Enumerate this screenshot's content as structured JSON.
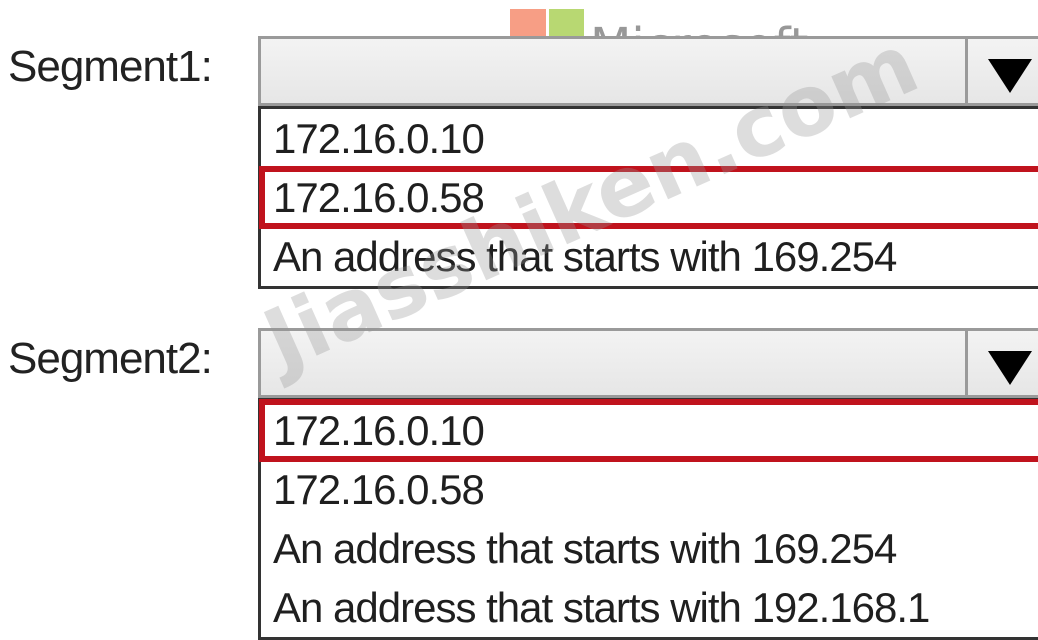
{
  "logo": {
    "text": "Microsoft",
    "colors": [
      "#f25022",
      "#7fba00",
      "#00a4ef",
      "#ffb900"
    ]
  },
  "watermark": {
    "text": "Jiasshiken.com"
  },
  "segments": [
    {
      "label": "Segment1:",
      "selected_value": "",
      "options": [
        "172.16.0.10",
        "172.16.0.58",
        "An address that starts with 169.254"
      ],
      "selected_index": 1
    },
    {
      "label": "Segment2:",
      "selected_value": "",
      "options": [
        "172.16.0.10",
        "172.16.0.58",
        "An address that starts with 169.254",
        "An address that starts with 192.168.1"
      ],
      "selected_index": 0
    }
  ],
  "colors": {
    "selection_outline": "#c0131d"
  }
}
